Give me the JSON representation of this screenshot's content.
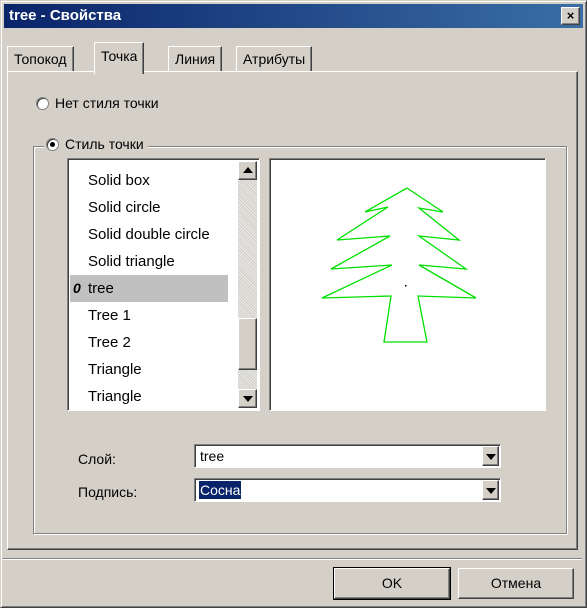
{
  "window": {
    "title": "tree - Свойства",
    "close_label": "×"
  },
  "tabs": [
    {
      "label": "Топокод",
      "active": false
    },
    {
      "label": "Точка",
      "active": true
    },
    {
      "label": "Линия",
      "active": false
    },
    {
      "label": "Атрибуты",
      "active": false
    }
  ],
  "point_style": {
    "no_style_label": "Нет стиля точки",
    "no_style_selected": false,
    "style_label": "Стиль точки",
    "style_selected": true,
    "list_items": [
      "Solid box",
      "Solid circle",
      "Solid double circle",
      "Solid triangle",
      "tree",
      "Tree 1",
      "Tree 2",
      "Triangle",
      "Triangle"
    ],
    "selected_index": 4,
    "selected_marker": "0",
    "preview_color": "#00e000"
  },
  "fields": {
    "layer_label": "Слой:",
    "layer_value": "tree",
    "caption_label": "Подпись:",
    "caption_value": "Сосна"
  },
  "buttons": {
    "ok_label": "OK",
    "cancel_label": "Отмена"
  },
  "colors": {
    "title_bar": "#0a246a",
    "selection": "#0a246a",
    "face": "#d4d0c8"
  }
}
